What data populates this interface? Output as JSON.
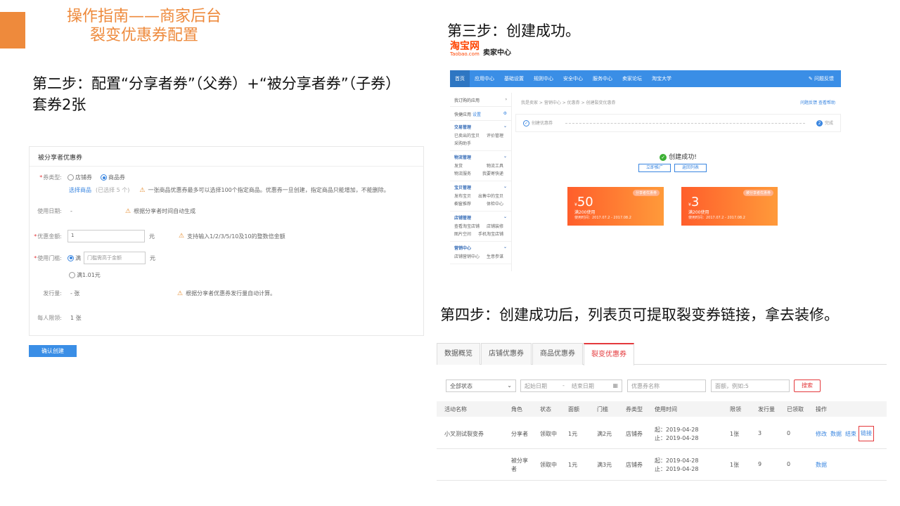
{
  "slide": {
    "title_line1": "操作指南——商家后台",
    "title_line2": "裂变优惠券配置",
    "step2": "第二步：配置“分享者券”（父券）+“被分享者券”（子券）套券2张",
    "step3": "第三步：创建成功。",
    "step4": "第四步：创建成功后，列表页可提取裂变券链接，拿去装修。"
  },
  "config_panel": {
    "header": "被分享者优惠券",
    "coupon_type_label": "券类型:",
    "coupon_type_opt1": "店铺券",
    "coupon_type_opt2": "商品券",
    "select_goods": "选择商品",
    "selected_count": "(已选择 5 个)",
    "goods_tip": "一张商品优惠券最多可以选择100个指定商品。优惠券一旦创建，指定商品只能增加，不能删除。",
    "date_label": "使用日期:",
    "date_value": "-",
    "date_tip": "根据分享者时间自动生成",
    "amount_label": "优惠金额:",
    "amount_value": "1",
    "amount_unit": "元",
    "amount_tip": "支持输入1/2/3/5/10及10的整数倍金额",
    "threshold_label": "使用门槛:",
    "threshold_opt1": "满",
    "threshold_placeholder": "门槛需高于金额",
    "threshold_unit": "元",
    "threshold_opt2": "满1.01元",
    "issue_label": "发行量:",
    "issue_value": "- 张",
    "issue_tip": "根据分享者优惠券发行量自动计算。",
    "limit_label": "每人限领:",
    "limit_value": "1 张",
    "confirm_button": "确认创建"
  },
  "step3_shot": {
    "brand": "淘宝网",
    "domain": "Taobao.com",
    "seller_center": "卖家中心",
    "nav": [
      "首页",
      "应用中心",
      "基础设置",
      "规则中心",
      "安全中心",
      "服务中心",
      "卖家论坛",
      "淘宝大学"
    ],
    "nav_feedback": "问题反馈",
    "side_top1": "我订购的应用",
    "side_top2": "快捷应用",
    "side_top2_setting": "设置",
    "groups": [
      {
        "title": "交易管理",
        "items": [
          "已卖出的宝贝",
          "评价管理",
          "采购助手",
          ""
        ]
      },
      {
        "title": "物流管理",
        "items": [
          "发货",
          "物流工具",
          "物流服务",
          "我要寄快递"
        ]
      },
      {
        "title": "宝贝管理",
        "items": [
          "发布宝贝",
          "出售中的宝贝",
          "橱窗推荐",
          "体检中心"
        ]
      },
      {
        "title": "店铺管理",
        "items": [
          "查看淘宝店铺",
          "店铺装修",
          "图片空间",
          "手机淘宝店铺"
        ]
      },
      {
        "title": "营销中心",
        "items": [
          "店铺营销中心",
          "生意参谋",
          "",
          ""
        ]
      }
    ],
    "breadcrumb": "我是卖家 > 营销中心 > 优惠券 > 创建裂变优惠券",
    "crumb_links": "问题反馈 查看帮助",
    "step_a": "创建优惠券",
    "step_b_num": "2",
    "step_b": "完成",
    "success_text": "创建成功!",
    "btn_promote": "立即推广",
    "btn_back": "返回列表",
    "coupons": [
      {
        "tag": "分享者优惠券",
        "currency": "¥",
        "amount": "50",
        "cond": "满200使用",
        "date": "使用时间：2017.07.2 - 2017.08.2"
      },
      {
        "tag": "被分享者优惠券",
        "currency": "¥",
        "amount": "3",
        "cond": "满200使用",
        "date": "使用时间：2017.07.2 - 2017.08.2"
      }
    ]
  },
  "step4_shot": {
    "tabs": [
      "数据概览",
      "店铺优惠券",
      "商品优惠券",
      "裂变优惠券"
    ],
    "active_tab": 3,
    "status_select": "全部状态",
    "date_start": "起始日期",
    "date_sep": "-",
    "date_end": "结束日期",
    "name_placeholder": "优惠券名称",
    "face_placeholder": "面额，例如:5",
    "search_button": "搜索",
    "columns": [
      "活动名称",
      "角色",
      "状态",
      "面额",
      "门槛",
      "券类型",
      "使用时间",
      "限领",
      "发行量",
      "已领取",
      "操作"
    ],
    "rows": [
      {
        "name": "小叉测试裂变券",
        "role": "分享者",
        "status": "领取中",
        "face": "1元",
        "threshold": "满2元",
        "type": "店铺券",
        "start": "起：2019-04-28",
        "end": "止：2019-04-28",
        "limit": "1张",
        "issued": "3",
        "received": "0",
        "ops": [
          "修改",
          "数据",
          "结束",
          "链接"
        ]
      },
      {
        "name": "",
        "role": "被分享者",
        "status": "领取中",
        "face": "1元",
        "threshold": "满3元",
        "type": "店铺券",
        "start": "起：2019-04-28",
        "end": "止：2019-04-28",
        "limit": "1张",
        "issued": "9",
        "received": "0",
        "ops": [
          "数据"
        ]
      }
    ]
  }
}
